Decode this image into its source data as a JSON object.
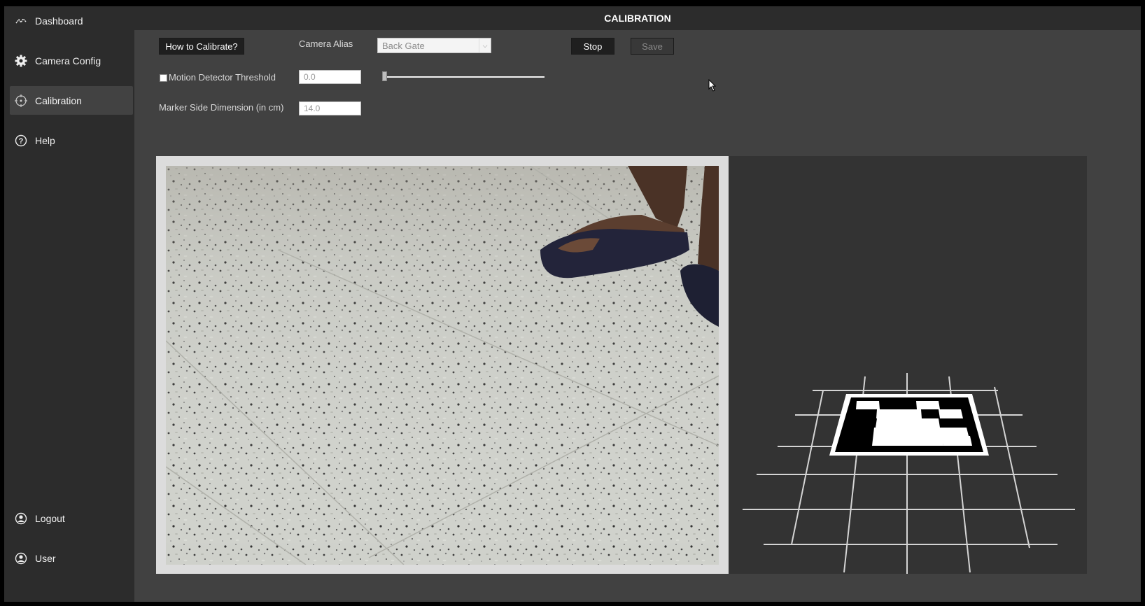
{
  "header": {
    "title": "CALIBRATION"
  },
  "sidebar": {
    "items": [
      {
        "label": "Dashboard",
        "icon": "activity-icon",
        "active": false
      },
      {
        "label": "Camera Config",
        "icon": "gear-icon",
        "active": false
      },
      {
        "label": "Calibration",
        "icon": "crosshair-icon",
        "active": true
      },
      {
        "label": "Help",
        "icon": "help-icon",
        "active": false
      }
    ],
    "bottom": [
      {
        "label": "Logout",
        "icon": "user-icon"
      },
      {
        "label": "User",
        "icon": "user-icon"
      }
    ]
  },
  "toolbar": {
    "how_to_label": "How to Calibrate?",
    "camera_alias_label": "Camera Alias",
    "camera_alias_value": "Back Gate",
    "stop_label": "Stop",
    "save_label": "Save"
  },
  "settings": {
    "motion_label": "Motion Detector Threshold",
    "motion_value": "0.0",
    "motion_slider_level": 0,
    "marker_label": "Marker Side Dimension (in cm)",
    "marker_value": "14.0"
  },
  "colors": {
    "background": "#414141",
    "sidebar": "#2c2c2c",
    "active_item": "#424242",
    "button": "#1f1f1f"
  }
}
